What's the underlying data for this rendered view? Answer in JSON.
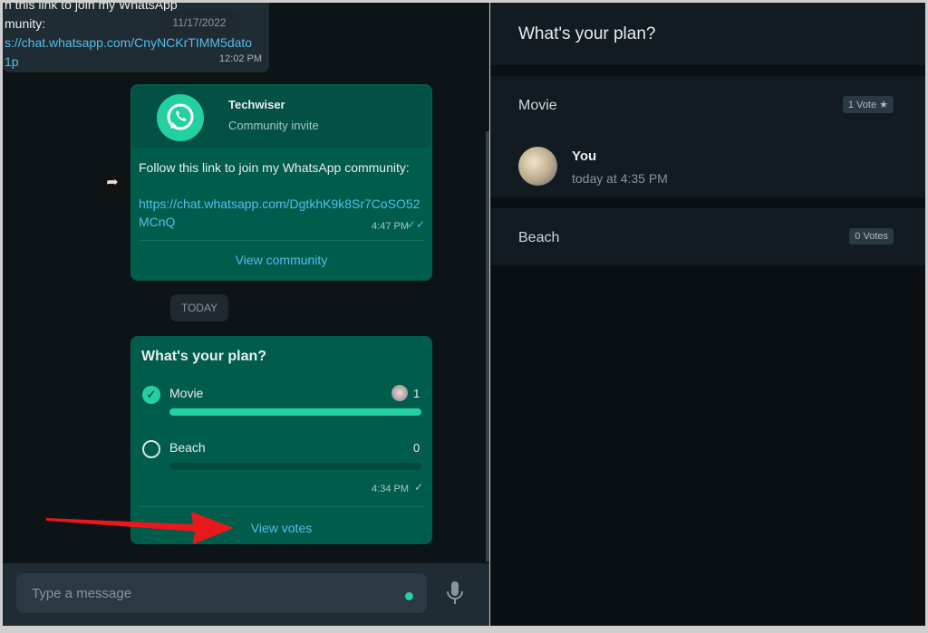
{
  "chat": {
    "old_message": {
      "line1": "n this link to join my WhatsApp",
      "line2": "munity:",
      "link1": "s://chat.whatsapp.com/CnyNCKrTIMM5dato",
      "link2": "1p",
      "time": "12:02 PM"
    },
    "date_pill": "11/17/2022",
    "community_invite": {
      "name": "Techwiser",
      "subtitle": "Community invite",
      "text": "Follow this link to join my WhatsApp community:",
      "link": "https://chat.whatsapp.com/DgtkhK9k8Sr7CoSO52MCnQ",
      "time": "4:47 PM",
      "action": "View community"
    },
    "today_pill": "TODAY",
    "poll": {
      "question": "What's your plan?",
      "options": [
        {
          "label": "Movie",
          "count": "1",
          "selected": true,
          "fill": 1.0
        },
        {
          "label": "Beach",
          "count": "0",
          "selected": false,
          "fill": 0.0
        }
      ],
      "time": "4:34 PM",
      "action": "View votes"
    },
    "composer": {
      "placeholder": "Type a message"
    }
  },
  "votes_panel": {
    "title": "What's your plan?",
    "options": [
      {
        "label": "Movie",
        "badge": "1 Vote ★",
        "voters": [
          {
            "name": "You",
            "time": "today at 4:35 PM"
          }
        ]
      },
      {
        "label": "Beach",
        "badge": "0 Votes"
      }
    ]
  },
  "colors": {
    "accent": "#00a884",
    "bubble_out": "#005c4b",
    "annotation_arrow": "#e8181c"
  }
}
